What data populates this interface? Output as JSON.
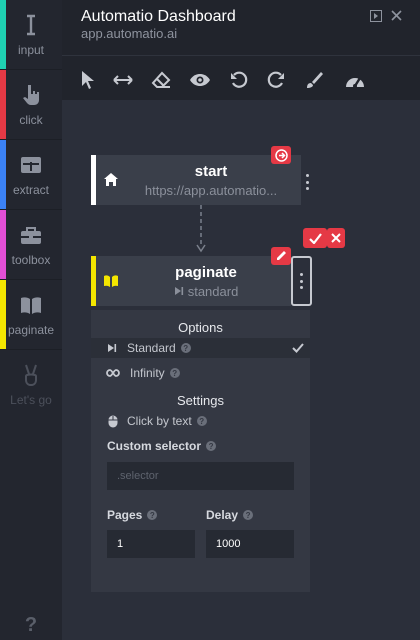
{
  "sidebar": {
    "items": [
      {
        "label": "input",
        "icon": "text-cursor-icon",
        "color": "#1fd1b2"
      },
      {
        "label": "click",
        "icon": "pointer-hand-icon",
        "color": "#e53945"
      },
      {
        "label": "extract",
        "icon": "table-icon",
        "color": "#3b82f6"
      },
      {
        "label": "toolbox",
        "icon": "toolbox-icon",
        "color": "#e34fd6"
      },
      {
        "label": "paginate",
        "icon": "book-icon",
        "color": "#f4e600"
      },
      {
        "label": "Let's go",
        "icon": "victory-hand-icon",
        "color": ""
      }
    ],
    "help": "?"
  },
  "header": {
    "title": "Automatio Dashboard",
    "url": "app.automatio.ai"
  },
  "toolbar": {
    "tools": [
      "pointer-icon",
      "resize-arrows-icon",
      "eraser-icon",
      "eye-icon",
      "undo-icon",
      "redo-icon",
      "brush-icon",
      "speedometer-icon"
    ]
  },
  "nodes": {
    "start": {
      "name": "start",
      "subtitle": "https://app.automatio..."
    },
    "paginate": {
      "name": "paginate",
      "subtitle": "standard"
    }
  },
  "panel": {
    "options_title": "Options",
    "options": [
      {
        "label": "Standard",
        "selected": true
      },
      {
        "label": "Infinity",
        "selected": false
      }
    ],
    "settings_title": "Settings",
    "click_mode": "Click by text",
    "custom_selector_label": "Custom selector",
    "custom_selector_placeholder": ".selector",
    "pages_label": "Pages",
    "pages_value": "1",
    "delay_label": "Delay",
    "delay_value": "1000"
  },
  "colors": {
    "accent_red": "#e53945",
    "paginate_yellow": "#f4e600"
  }
}
